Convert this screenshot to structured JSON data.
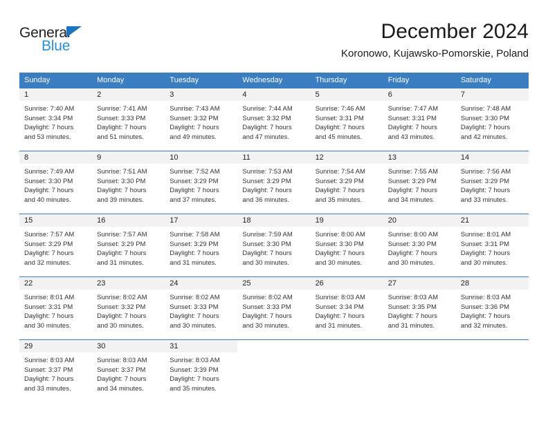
{
  "brand": {
    "name_top": "General",
    "name_bottom": "Blue",
    "color_top": "#231f20",
    "color_bottom": "#2b8fd4",
    "triangle_color": "#1c75bc"
  },
  "header": {
    "title": "December 2024",
    "subtitle": "Koronowo, Kujawsko-Pomorskie, Poland"
  },
  "theme": {
    "header_bar": "#3a7dc0",
    "daynum_strip": "#f2f2f2",
    "text": "#333333"
  },
  "calendar": {
    "weekday_headers": [
      "Sunday",
      "Monday",
      "Tuesday",
      "Wednesday",
      "Thursday",
      "Friday",
      "Saturday"
    ],
    "weeks": [
      [
        {
          "day": "1",
          "sunrise": "Sunrise: 7:40 AM",
          "sunset": "Sunset: 3:34 PM",
          "daylight1": "Daylight: 7 hours",
          "daylight2": "and 53 minutes."
        },
        {
          "day": "2",
          "sunrise": "Sunrise: 7:41 AM",
          "sunset": "Sunset: 3:33 PM",
          "daylight1": "Daylight: 7 hours",
          "daylight2": "and 51 minutes."
        },
        {
          "day": "3",
          "sunrise": "Sunrise: 7:43 AM",
          "sunset": "Sunset: 3:32 PM",
          "daylight1": "Daylight: 7 hours",
          "daylight2": "and 49 minutes."
        },
        {
          "day": "4",
          "sunrise": "Sunrise: 7:44 AM",
          "sunset": "Sunset: 3:32 PM",
          "daylight1": "Daylight: 7 hours",
          "daylight2": "and 47 minutes."
        },
        {
          "day": "5",
          "sunrise": "Sunrise: 7:46 AM",
          "sunset": "Sunset: 3:31 PM",
          "daylight1": "Daylight: 7 hours",
          "daylight2": "and 45 minutes."
        },
        {
          "day": "6",
          "sunrise": "Sunrise: 7:47 AM",
          "sunset": "Sunset: 3:31 PM",
          "daylight1": "Daylight: 7 hours",
          "daylight2": "and 43 minutes."
        },
        {
          "day": "7",
          "sunrise": "Sunrise: 7:48 AM",
          "sunset": "Sunset: 3:30 PM",
          "daylight1": "Daylight: 7 hours",
          "daylight2": "and 42 minutes."
        }
      ],
      [
        {
          "day": "8",
          "sunrise": "Sunrise: 7:49 AM",
          "sunset": "Sunset: 3:30 PM",
          "daylight1": "Daylight: 7 hours",
          "daylight2": "and 40 minutes."
        },
        {
          "day": "9",
          "sunrise": "Sunrise: 7:51 AM",
          "sunset": "Sunset: 3:30 PM",
          "daylight1": "Daylight: 7 hours",
          "daylight2": "and 39 minutes."
        },
        {
          "day": "10",
          "sunrise": "Sunrise: 7:52 AM",
          "sunset": "Sunset: 3:29 PM",
          "daylight1": "Daylight: 7 hours",
          "daylight2": "and 37 minutes."
        },
        {
          "day": "11",
          "sunrise": "Sunrise: 7:53 AM",
          "sunset": "Sunset: 3:29 PM",
          "daylight1": "Daylight: 7 hours",
          "daylight2": "and 36 minutes."
        },
        {
          "day": "12",
          "sunrise": "Sunrise: 7:54 AM",
          "sunset": "Sunset: 3:29 PM",
          "daylight1": "Daylight: 7 hours",
          "daylight2": "and 35 minutes."
        },
        {
          "day": "13",
          "sunrise": "Sunrise: 7:55 AM",
          "sunset": "Sunset: 3:29 PM",
          "daylight1": "Daylight: 7 hours",
          "daylight2": "and 34 minutes."
        },
        {
          "day": "14",
          "sunrise": "Sunrise: 7:56 AM",
          "sunset": "Sunset: 3:29 PM",
          "daylight1": "Daylight: 7 hours",
          "daylight2": "and 33 minutes."
        }
      ],
      [
        {
          "day": "15",
          "sunrise": "Sunrise: 7:57 AM",
          "sunset": "Sunset: 3:29 PM",
          "daylight1": "Daylight: 7 hours",
          "daylight2": "and 32 minutes."
        },
        {
          "day": "16",
          "sunrise": "Sunrise: 7:57 AM",
          "sunset": "Sunset: 3:29 PM",
          "daylight1": "Daylight: 7 hours",
          "daylight2": "and 31 minutes."
        },
        {
          "day": "17",
          "sunrise": "Sunrise: 7:58 AM",
          "sunset": "Sunset: 3:29 PM",
          "daylight1": "Daylight: 7 hours",
          "daylight2": "and 31 minutes."
        },
        {
          "day": "18",
          "sunrise": "Sunrise: 7:59 AM",
          "sunset": "Sunset: 3:30 PM",
          "daylight1": "Daylight: 7 hours",
          "daylight2": "and 30 minutes."
        },
        {
          "day": "19",
          "sunrise": "Sunrise: 8:00 AM",
          "sunset": "Sunset: 3:30 PM",
          "daylight1": "Daylight: 7 hours",
          "daylight2": "and 30 minutes."
        },
        {
          "day": "20",
          "sunrise": "Sunrise: 8:00 AM",
          "sunset": "Sunset: 3:30 PM",
          "daylight1": "Daylight: 7 hours",
          "daylight2": "and 30 minutes."
        },
        {
          "day": "21",
          "sunrise": "Sunrise: 8:01 AM",
          "sunset": "Sunset: 3:31 PM",
          "daylight1": "Daylight: 7 hours",
          "daylight2": "and 30 minutes."
        }
      ],
      [
        {
          "day": "22",
          "sunrise": "Sunrise: 8:01 AM",
          "sunset": "Sunset: 3:31 PM",
          "daylight1": "Daylight: 7 hours",
          "daylight2": "and 30 minutes."
        },
        {
          "day": "23",
          "sunrise": "Sunrise: 8:02 AM",
          "sunset": "Sunset: 3:32 PM",
          "daylight1": "Daylight: 7 hours",
          "daylight2": "and 30 minutes."
        },
        {
          "day": "24",
          "sunrise": "Sunrise: 8:02 AM",
          "sunset": "Sunset: 3:33 PM",
          "daylight1": "Daylight: 7 hours",
          "daylight2": "and 30 minutes."
        },
        {
          "day": "25",
          "sunrise": "Sunrise: 8:02 AM",
          "sunset": "Sunset: 3:33 PM",
          "daylight1": "Daylight: 7 hours",
          "daylight2": "and 30 minutes."
        },
        {
          "day": "26",
          "sunrise": "Sunrise: 8:03 AM",
          "sunset": "Sunset: 3:34 PM",
          "daylight1": "Daylight: 7 hours",
          "daylight2": "and 31 minutes."
        },
        {
          "day": "27",
          "sunrise": "Sunrise: 8:03 AM",
          "sunset": "Sunset: 3:35 PM",
          "daylight1": "Daylight: 7 hours",
          "daylight2": "and 31 minutes."
        },
        {
          "day": "28",
          "sunrise": "Sunrise: 8:03 AM",
          "sunset": "Sunset: 3:36 PM",
          "daylight1": "Daylight: 7 hours",
          "daylight2": "and 32 minutes."
        }
      ],
      [
        {
          "day": "29",
          "sunrise": "Sunrise: 8:03 AM",
          "sunset": "Sunset: 3:37 PM",
          "daylight1": "Daylight: 7 hours",
          "daylight2": "and 33 minutes."
        },
        {
          "day": "30",
          "sunrise": "Sunrise: 8:03 AM",
          "sunset": "Sunset: 3:37 PM",
          "daylight1": "Daylight: 7 hours",
          "daylight2": "and 34 minutes."
        },
        {
          "day": "31",
          "sunrise": "Sunrise: 8:03 AM",
          "sunset": "Sunset: 3:39 PM",
          "daylight1": "Daylight: 7 hours",
          "daylight2": "and 35 minutes."
        },
        {
          "day": "",
          "sunrise": "",
          "sunset": "",
          "daylight1": "",
          "daylight2": ""
        },
        {
          "day": "",
          "sunrise": "",
          "sunset": "",
          "daylight1": "",
          "daylight2": ""
        },
        {
          "day": "",
          "sunrise": "",
          "sunset": "",
          "daylight1": "",
          "daylight2": ""
        },
        {
          "day": "",
          "sunrise": "",
          "sunset": "",
          "daylight1": "",
          "daylight2": ""
        }
      ]
    ]
  }
}
